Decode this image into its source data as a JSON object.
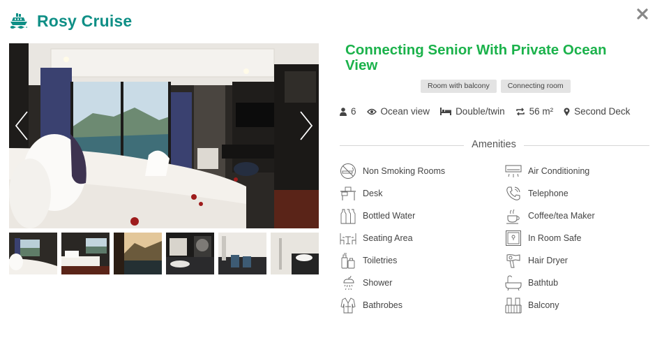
{
  "brand": {
    "name": "Rosy Cruise",
    "icon": "cruise-ship-icon",
    "color": "#0f8f86"
  },
  "close": {
    "icon": "close-icon"
  },
  "room": {
    "title": "Connecting Senior With Private Ocean View",
    "title_color": "#1bb24b",
    "tags": [
      "Room with balcony",
      "Connecting room"
    ],
    "facts": [
      {
        "icon": "person-icon",
        "value": "6"
      },
      {
        "icon": "eye-icon",
        "value": "Ocean view"
      },
      {
        "icon": "bed-icon",
        "value": "Double/twin"
      },
      {
        "icon": "area-icon",
        "value": "56 m²"
      },
      {
        "icon": "map-marker-icon",
        "value": "Second Deck"
      }
    ]
  },
  "gallery": {
    "prev_icon": "chevron-left-icon",
    "next_icon": "chevron-right-icon",
    "thumbnail_count": 6
  },
  "amenities": {
    "heading": "Amenities",
    "items": [
      {
        "label": "Non Smoking Rooms",
        "icon": "no-smoking-icon"
      },
      {
        "label": "Air Conditioning",
        "icon": "air-conditioner-icon"
      },
      {
        "label": "Desk",
        "icon": "desk-icon"
      },
      {
        "label": "Telephone",
        "icon": "telephone-icon"
      },
      {
        "label": "Bottled Water",
        "icon": "bottled-water-icon"
      },
      {
        "label": "Coffee/tea Maker",
        "icon": "coffee-maker-icon"
      },
      {
        "label": "Seating Area",
        "icon": "seating-area-icon"
      },
      {
        "label": "In Room Safe",
        "icon": "safe-icon"
      },
      {
        "label": "Toiletries",
        "icon": "toiletries-icon"
      },
      {
        "label": "Hair Dryer",
        "icon": "hair-dryer-icon"
      },
      {
        "label": "Shower",
        "icon": "shower-icon"
      },
      {
        "label": "Bathtub",
        "icon": "bathtub-icon"
      },
      {
        "label": "Bathrobes",
        "icon": "bathrobe-icon"
      },
      {
        "label": "Balcony",
        "icon": "balcony-icon"
      }
    ]
  }
}
